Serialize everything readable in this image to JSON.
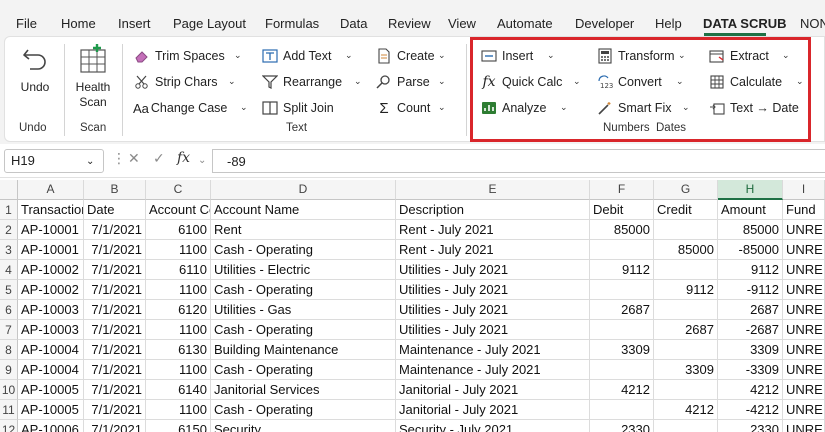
{
  "menu": {
    "tabs": [
      "File",
      "Home",
      "Insert",
      "Page Layout",
      "Formulas",
      "Data",
      "Review",
      "View",
      "Automate",
      "Developer",
      "Help",
      "DATA SCRUB",
      "NON"
    ],
    "active": "DATA SCRUB"
  },
  "ribbon": {
    "undo": {
      "label": "Undo",
      "group": "Undo"
    },
    "scan": {
      "label_line1": "Health",
      "label_line2": "Scan",
      "group": "Scan"
    },
    "text_group": {
      "label": "Text",
      "trim_spaces": "Trim Spaces",
      "strip_chars": "Strip Chars",
      "change_case": "Change Case",
      "add_text": "Add Text",
      "rearrange": "Rearrange",
      "split_join": "Split  Join",
      "create": "Create",
      "parse": "Parse",
      "count": "Count"
    },
    "numbers_group": {
      "label": "Numbers",
      "insert": "Insert",
      "quick_calc": "Quick Calc",
      "analyze": "Analyze",
      "transform": "Transform",
      "convert": "Convert",
      "smart_fix": "Smart Fix"
    },
    "dates_group": {
      "label": "Dates",
      "extract": "Extract",
      "calculate": "Calculate",
      "text_to_date": "Text → Date"
    }
  },
  "formula_bar": {
    "cell_ref": "H19",
    "formula": "-89"
  },
  "columns": [
    {
      "letter": "A",
      "header": "Transaction ID"
    },
    {
      "letter": "B",
      "header": "Date"
    },
    {
      "letter": "C",
      "header": "Account Code"
    },
    {
      "letter": "D",
      "header": "Account Name"
    },
    {
      "letter": "E",
      "header": "Description"
    },
    {
      "letter": "F",
      "header": "Debit"
    },
    {
      "letter": "G",
      "header": "Credit"
    },
    {
      "letter": "H",
      "header": "Amount"
    },
    {
      "letter": "I",
      "header": "Fund"
    }
  ],
  "rows": [
    [
      "AP-10001",
      "7/1/2021",
      "6100",
      "Rent",
      "Rent - July 2021",
      "85000",
      "",
      "85000",
      "UNRE"
    ],
    [
      "AP-10001",
      "7/1/2021",
      "1100",
      "Cash - Operating",
      "Rent - July 2021",
      "",
      "85000",
      "-85000",
      "UNRE"
    ],
    [
      "AP-10002",
      "7/1/2021",
      "6110",
      "Utilities - Electric",
      "Utilities - July 2021",
      "9112",
      "",
      "9112",
      "UNRE"
    ],
    [
      "AP-10002",
      "7/1/2021",
      "1100",
      "Cash - Operating",
      "Utilities - July 2021",
      "",
      "9112",
      "-9112",
      "UNRE"
    ],
    [
      "AP-10003",
      "7/1/2021",
      "6120",
      "Utilities - Gas",
      "Utilities - July 2021",
      "2687",
      "",
      "2687",
      "UNRE"
    ],
    [
      "AP-10003",
      "7/1/2021",
      "1100",
      "Cash - Operating",
      "Utilities - July 2021",
      "",
      "2687",
      "-2687",
      "UNRE"
    ],
    [
      "AP-10004",
      "7/1/2021",
      "6130",
      "Building Maintenance",
      "Maintenance - July 2021",
      "3309",
      "",
      "3309",
      "UNRE"
    ],
    [
      "AP-10004",
      "7/1/2021",
      "1100",
      "Cash - Operating",
      "Maintenance - July 2021",
      "",
      "3309",
      "-3309",
      "UNRE"
    ],
    [
      "AP-10005",
      "7/1/2021",
      "6140",
      "Janitorial Services",
      "Janitorial - July 2021",
      "4212",
      "",
      "4212",
      "UNRE"
    ],
    [
      "AP-10005",
      "7/1/2021",
      "1100",
      "Cash - Operating",
      "Janitorial - July 2021",
      "",
      "4212",
      "-4212",
      "UNRE"
    ],
    [
      "AP-10006",
      "7/1/2021",
      "6150",
      "Security",
      "Security - July 2021",
      "2330",
      "",
      "2330",
      "UNRE"
    ]
  ]
}
